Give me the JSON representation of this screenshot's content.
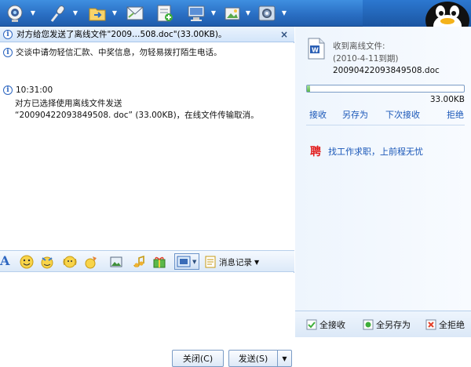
{
  "toolbar": {
    "icons": [
      "video-call-icon",
      "voice-call-icon",
      "send-file-icon",
      "email-icon",
      "app-add-icon",
      "remote-assist-icon",
      "photo-icon",
      "settings-icon"
    ]
  },
  "notice": {
    "text": "对方给您发送了离线文件\"2009…508.doc\"(33.00KB)。",
    "close": "×"
  },
  "messages": {
    "warning": "交谈中请勿轻信汇款、中奖信息，勿轻易拨打陌生电话。",
    "time": "10:31:00",
    "line1": "对方已选择使用离线文件发送",
    "line2": "“20090422093849508. doc” (33.00KB)，在线文件传输取消。"
  },
  "format_bar": {
    "font_label": "A",
    "history_label": "消息记录"
  },
  "buttons": {
    "close": "关闭(C)",
    "send": "发送(S)"
  },
  "transfer": {
    "heading": "收到离线文件:",
    "expiry": "(2010-4-11到期)",
    "filename": "20090422093849508.doc",
    "size": "33.00KB",
    "progress": 0.02,
    "actions": [
      "接收",
      "另存为",
      "下次接收",
      "拒绝"
    ]
  },
  "ad": {
    "icon": "聘",
    "text": "找工作求职，上前程无忧"
  },
  "bulk_actions": {
    "accept_all": "全接收",
    "save_all": "全另存为",
    "reject_all": "全拒绝"
  },
  "colors": {
    "toolbar": "#2a6fc4",
    "link": "#1a57b8",
    "ad_red": "#e21c1c"
  }
}
